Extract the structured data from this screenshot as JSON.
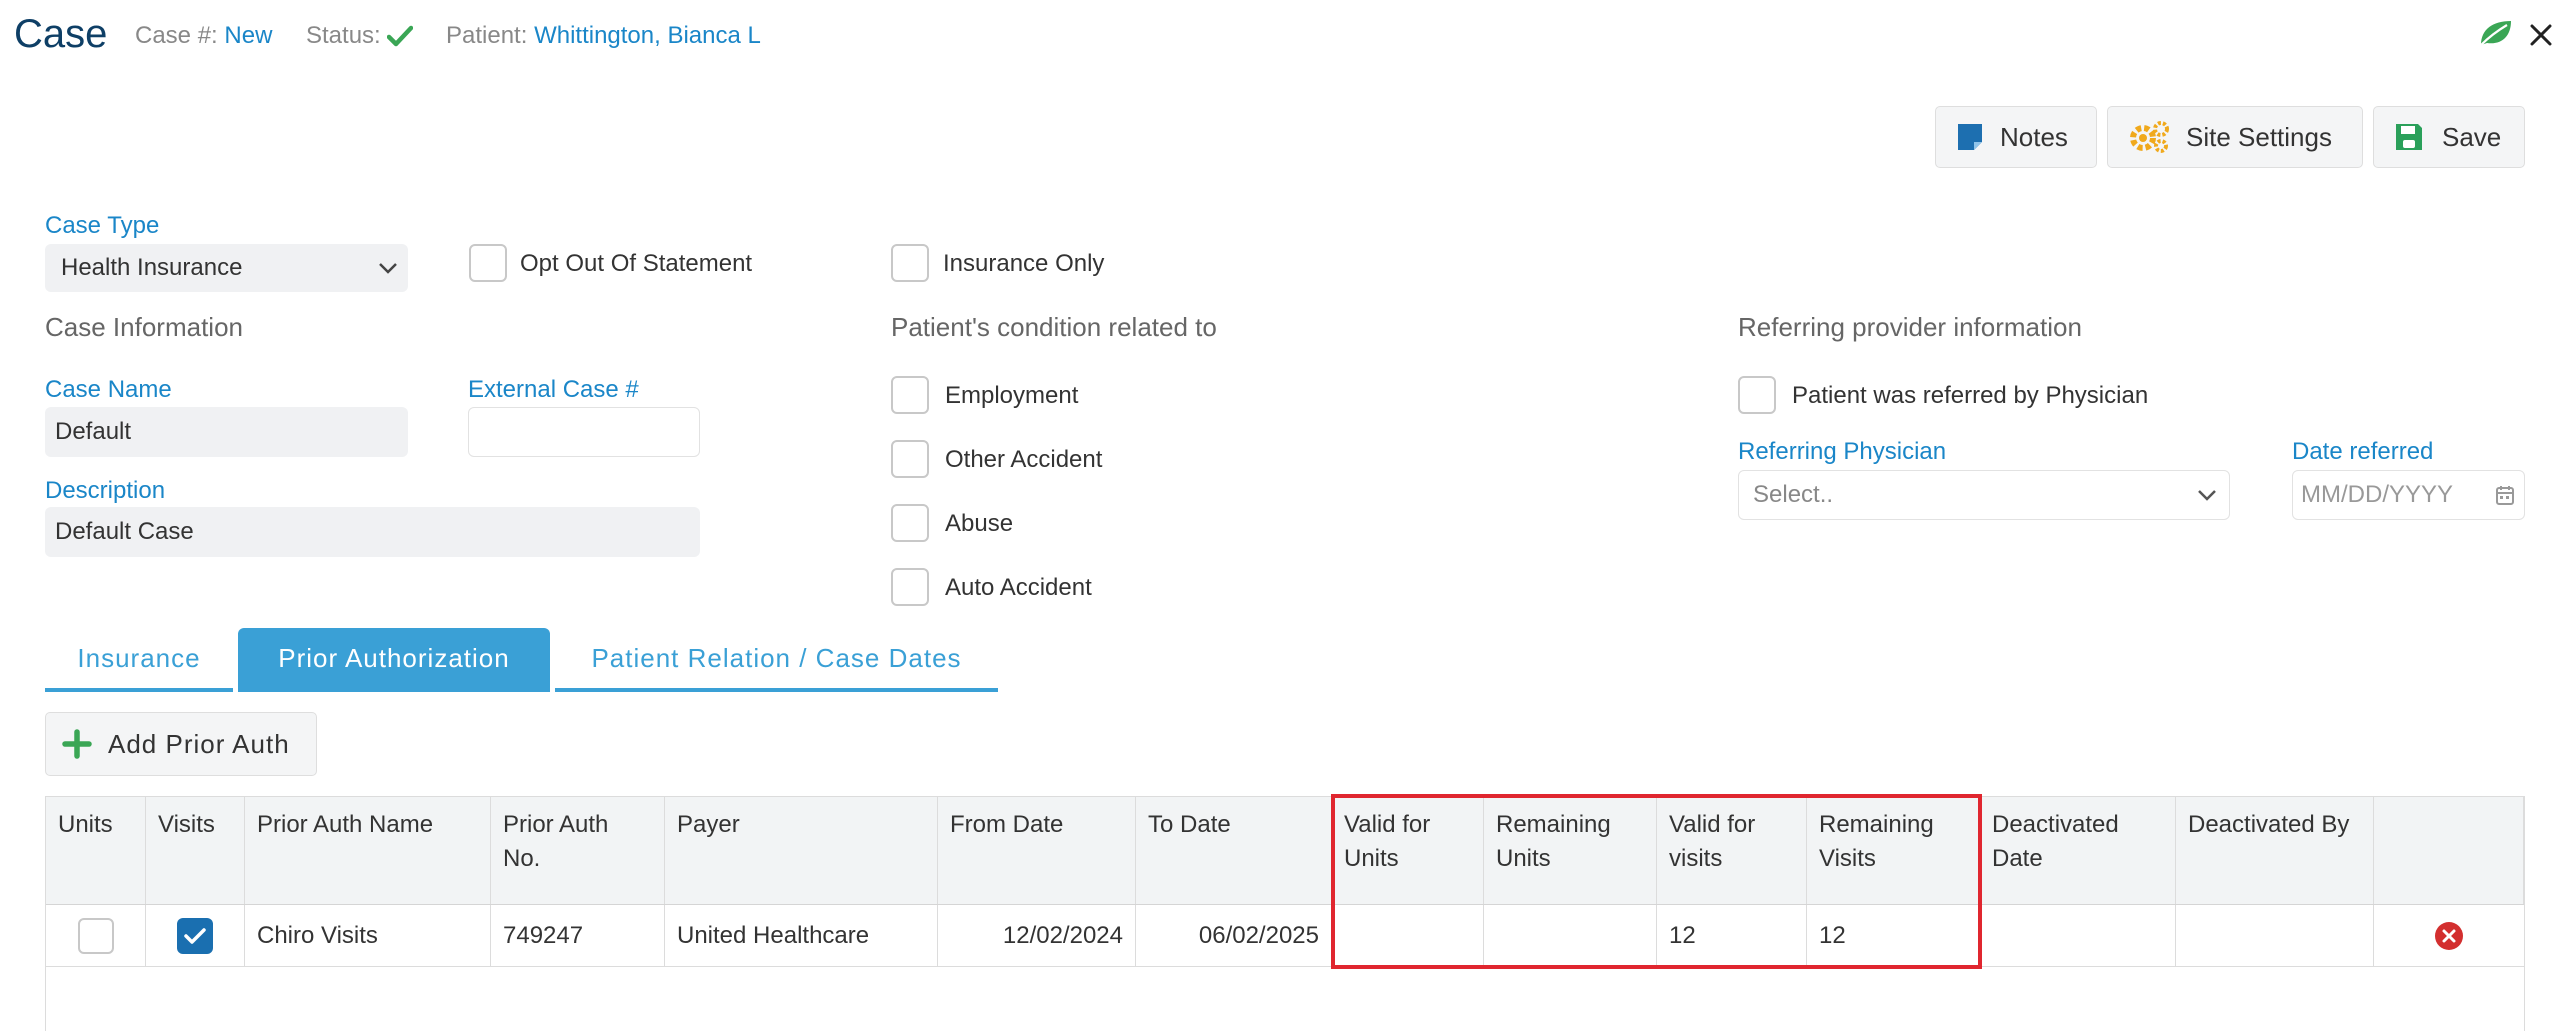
{
  "header": {
    "title": "Case",
    "case_no_label": "Case #:",
    "case_no_value": "New",
    "status_label": "Status:",
    "patient_label": "Patient:",
    "patient_value": "Whittington, Bianca L"
  },
  "toolbar": {
    "notes_label": "Notes",
    "site_settings_label": "Site Settings",
    "save_label": "Save"
  },
  "form": {
    "case_type_label": "Case Type",
    "case_type_value": "Health Insurance",
    "opt_out_label": "Opt Out Of Statement",
    "insurance_only_label": "Insurance Only",
    "case_info_title": "Case Information",
    "case_name_label": "Case Name",
    "case_name_value": "Default",
    "external_case_label": "External Case #",
    "external_case_value": "",
    "description_label": "Description",
    "description_value": "Default Case",
    "condition_title": "Patient's condition related to",
    "conditions": [
      "Employment",
      "Other Accident",
      "Abuse",
      "Auto Accident"
    ],
    "referring_title": "Referring provider information",
    "referred_by_physician_label": "Patient was referred by Physician",
    "referring_physician_label": "Referring Physician",
    "referring_physician_placeholder": "Select..",
    "date_referred_label": "Date referred",
    "date_referred_placeholder": "MM/DD/YYYY"
  },
  "tabs": [
    {
      "label": "Insurance",
      "active": false
    },
    {
      "label": "Prior Authorization",
      "active": true
    },
    {
      "label": "Patient Relation / Case Dates",
      "active": false
    }
  ],
  "prior_auth": {
    "add_label": "Add Prior Auth",
    "columns": [
      "Units",
      "Visits",
      "Prior Auth Name",
      "Prior Auth No.",
      "Payer",
      "From Date",
      "To Date",
      "Valid for Units",
      "Remaining Units",
      "Valid for visits",
      "Remaining Visits",
      "Deactivated Date",
      "Deactivated By",
      ""
    ],
    "rows": [
      {
        "units_checked": false,
        "visits_checked": true,
        "name": "Chiro Visits",
        "number": "749247",
        "payer": "United Healthcare",
        "from_date": "12/02/2024",
        "to_date": "06/02/2025",
        "valid_units": "",
        "remaining_units": "",
        "valid_visits": "12",
        "remaining_visits": "12",
        "deactivated_date": "",
        "deactivated_by": ""
      }
    ]
  },
  "colors": {
    "accent": "#3aa0d6",
    "label_blue": "#1a86c8",
    "highlight_red": "#e0262f",
    "delete_red": "#d32f2f",
    "success_green": "#3aa655"
  }
}
